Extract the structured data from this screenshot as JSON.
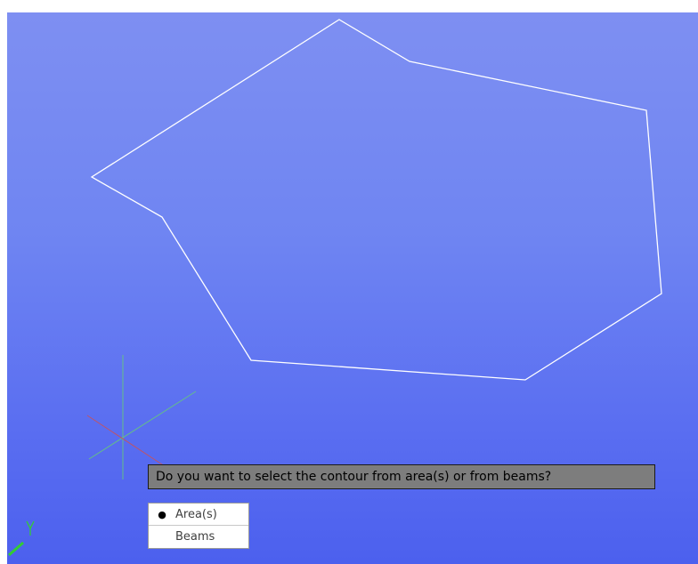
{
  "viewport": {
    "background_top": "#7e8ff2",
    "background_bottom": "#4c60ee",
    "contour_color": "#ffffff"
  },
  "axes": {
    "y_label": "Y",
    "y_color": "#33cc33",
    "x_color": "#cc4444",
    "green_color": "#5fcf6f"
  },
  "prompt": {
    "question": "Do you want to select the contour from area(s) or from beams?"
  },
  "options": [
    {
      "label": "Area(s)",
      "selected": true,
      "bullet": "●"
    },
    {
      "label": "Beams",
      "selected": false,
      "bullet": ""
    }
  ]
}
